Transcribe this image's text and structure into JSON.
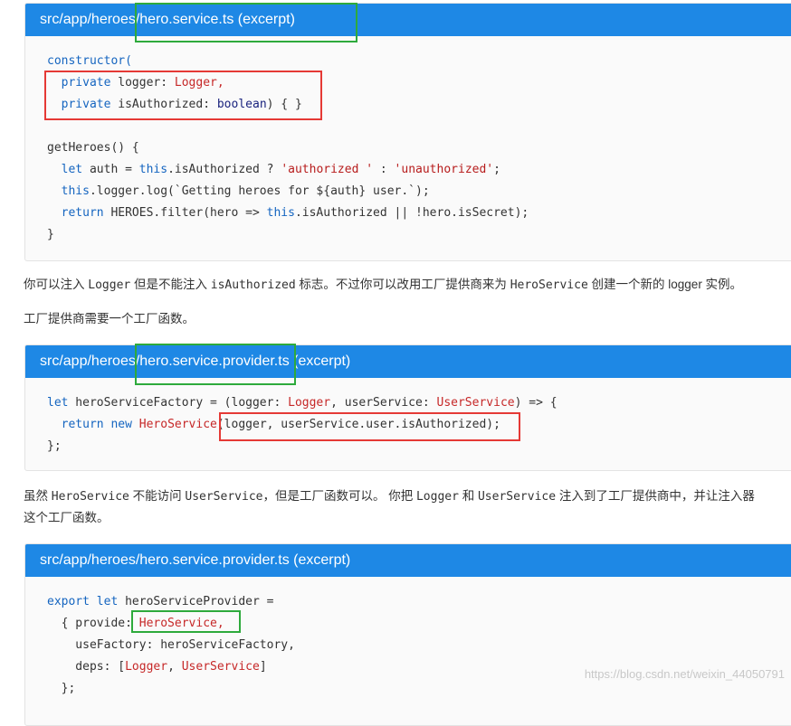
{
  "block1": {
    "title": "src/app/heroes/hero.service.ts (excerpt)",
    "lines": [
      [
        {
          "t": "constructor(",
          "c": "kw2"
        }
      ],
      [
        {
          "t": "  "
        },
        {
          "t": "private",
          "c": "kw2"
        },
        {
          "t": " logger: "
        },
        {
          "t": "Logger,",
          "c": "ty"
        }
      ],
      [
        {
          "t": "  "
        },
        {
          "t": "private",
          "c": "kw2"
        },
        {
          "t": " isAuthorized: "
        },
        {
          "t": "boolean",
          "c": "kw"
        },
        {
          "t": ") { }"
        }
      ],
      [
        {
          "t": ""
        }
      ],
      [
        {
          "t": "getHeroes() {"
        }
      ],
      [
        {
          "t": "  "
        },
        {
          "t": "let",
          "c": "kw2"
        },
        {
          "t": " auth = "
        },
        {
          "t": "this",
          "c": "kw2"
        },
        {
          "t": ".isAuthorized ? "
        },
        {
          "t": "'authorized '",
          "c": "str"
        },
        {
          "t": " : "
        },
        {
          "t": "'unauthorized'",
          "c": "str"
        },
        {
          "t": ";"
        }
      ],
      [
        {
          "t": "  "
        },
        {
          "t": "this",
          "c": "kw2"
        },
        {
          "t": ".logger.log(`Getting heroes for ${auth} user.`);"
        }
      ],
      [
        {
          "t": "  "
        },
        {
          "t": "return",
          "c": "kw2"
        },
        {
          "t": " HEROES.filter(hero => "
        },
        {
          "t": "this",
          "c": "kw2"
        },
        {
          "t": ".isAuthorized || !hero.isSecret);"
        }
      ],
      [
        {
          "t": "}"
        }
      ]
    ]
  },
  "para1": {
    "a": "你可以注入 ",
    "b": "Logger",
    "c": " 但是不能注入 ",
    "d": "isAuthorized",
    "e": " 标志。不过你可以改用工厂提供商来为 ",
    "f": "HeroService",
    "g": " 创建一个新的 logger 实例。"
  },
  "para2": "工厂提供商需要一个工厂函数。",
  "block2": {
    "title": "src/app/heroes/hero.service.provider.ts (excerpt)",
    "lines": [
      [
        {
          "t": "let",
          "c": "kw2"
        },
        {
          "t": " heroServiceFactory = (logger: "
        },
        {
          "t": "Logger",
          "c": "ty"
        },
        {
          "t": ", userService: "
        },
        {
          "t": "UserService",
          "c": "ty"
        },
        {
          "t": ") => {"
        }
      ],
      [
        {
          "t": "  "
        },
        {
          "t": "return",
          "c": "kw2"
        },
        {
          "t": " "
        },
        {
          "t": "new",
          "c": "kw2"
        },
        {
          "t": " "
        },
        {
          "t": "HeroService",
          "c": "ty"
        },
        {
          "t": "(logger, userService.user.isAuthorized);"
        }
      ],
      [
        {
          "t": "};"
        }
      ]
    ]
  },
  "para3": {
    "a": "虽然 ",
    "b": "HeroService",
    "c": " 不能访问 ",
    "d": "UserService",
    "e": "，但是工厂函数可以。 你把 ",
    "f": "Logger",
    "g": " 和 ",
    "h": "UserService",
    "i": " 注入到了工厂提供商中，并让注入器"
  },
  "para3b": "这个工厂函数。",
  "block3": {
    "title": "src/app/heroes/hero.service.provider.ts (excerpt)",
    "lines": [
      [
        {
          "t": "export",
          "c": "kw2"
        },
        {
          "t": " "
        },
        {
          "t": "let",
          "c": "kw2"
        },
        {
          "t": " heroServiceProvider ="
        }
      ],
      [
        {
          "t": "  { provide: "
        },
        {
          "t": "HeroService,",
          "c": "ty"
        }
      ],
      [
        {
          "t": "    useFactory: heroServiceFactory,"
        }
      ],
      [
        {
          "t": "    deps: ["
        },
        {
          "t": "Logger",
          "c": "ty"
        },
        {
          "t": ", "
        },
        {
          "t": "UserService",
          "c": "ty"
        },
        {
          "t": "]"
        }
      ],
      [
        {
          "t": "  };"
        }
      ]
    ]
  },
  "watermark": "https://blog.csdn.net/weixin_44050791"
}
